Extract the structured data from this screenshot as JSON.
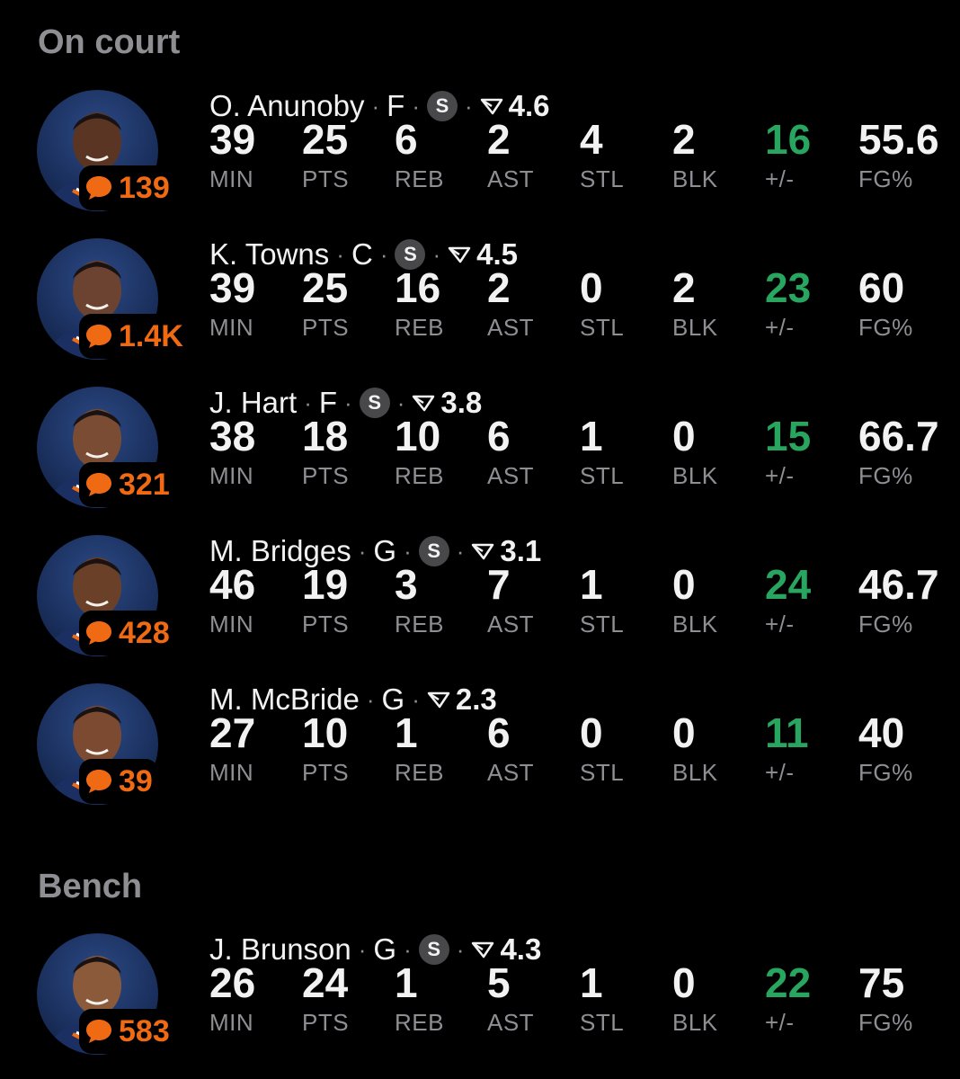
{
  "sections": {
    "on_court": {
      "title": "On court"
    },
    "bench": {
      "title": "Bench"
    }
  },
  "stat_labels": {
    "min": "MIN",
    "pts": "PTS",
    "reb": "REB",
    "ast": "AST",
    "stl": "STL",
    "blk": "BLK",
    "plus_minus": "+/-",
    "fg_pct": "FG%"
  },
  "starter_label": "S",
  "colors": {
    "background": "#000000",
    "comment_accent": "#f06a14",
    "positive_plus_minus": "#28a55f",
    "label_gray": "#8e8e93"
  },
  "icons": {
    "comment": "chat-bubble-icon",
    "rating": "rating-triangle-icon",
    "starter": "starter-badge"
  },
  "players": [
    {
      "name": "O. Anunoby",
      "position": "F",
      "starter": true,
      "rating": "4.6",
      "comments": "139",
      "stats": {
        "min": "39",
        "pts": "25",
        "reb": "6",
        "ast": "2",
        "stl": "4",
        "blk": "2",
        "plus_minus": "16",
        "fg_pct": "55.6"
      }
    },
    {
      "name": "K. Towns",
      "position": "C",
      "starter": true,
      "rating": "4.5",
      "comments": "1.4K",
      "stats": {
        "min": "39",
        "pts": "25",
        "reb": "16",
        "ast": "2",
        "stl": "0",
        "blk": "2",
        "plus_minus": "23",
        "fg_pct": "60"
      }
    },
    {
      "name": "J. Hart",
      "position": "F",
      "starter": true,
      "rating": "3.8",
      "comments": "321",
      "stats": {
        "min": "38",
        "pts": "18",
        "reb": "10",
        "ast": "6",
        "stl": "1",
        "blk": "0",
        "plus_minus": "15",
        "fg_pct": "66.7"
      }
    },
    {
      "name": "M. Bridges",
      "position": "G",
      "starter": true,
      "rating": "3.1",
      "comments": "428",
      "stats": {
        "min": "46",
        "pts": "19",
        "reb": "3",
        "ast": "7",
        "stl": "1",
        "blk": "0",
        "plus_minus": "24",
        "fg_pct": "46.7"
      }
    },
    {
      "name": "M. McBride",
      "position": "G",
      "starter": false,
      "rating": "2.3",
      "comments": "39",
      "stats": {
        "min": "27",
        "pts": "10",
        "reb": "1",
        "ast": "6",
        "stl": "0",
        "blk": "0",
        "plus_minus": "11",
        "fg_pct": "40"
      }
    },
    {
      "name": "J. Brunson",
      "position": "G",
      "starter": true,
      "rating": "4.3",
      "comments": "583",
      "stats": {
        "min": "26",
        "pts": "24",
        "reb": "1",
        "ast": "5",
        "stl": "1",
        "blk": "0",
        "plus_minus": "22",
        "fg_pct": "75"
      }
    }
  ]
}
